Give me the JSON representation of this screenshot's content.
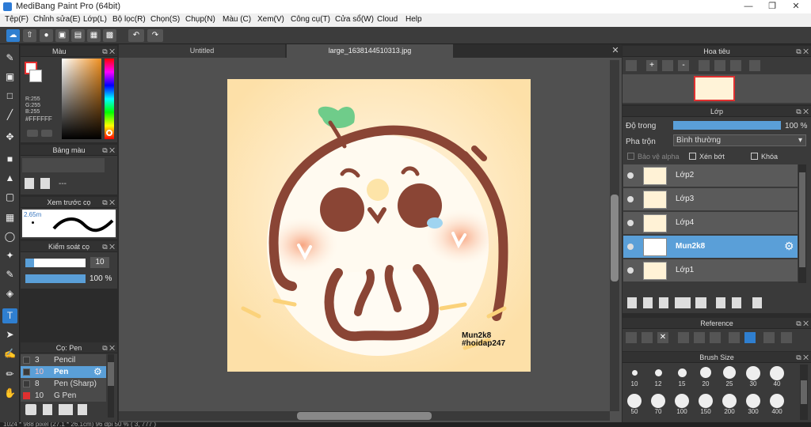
{
  "window": {
    "title": "MediBang Paint Pro (64bit)"
  },
  "menu": [
    "Tệp(F)",
    "Chỉnh sửa(E)",
    "Lớp(L)",
    "Bộ lọc(R)",
    "Chọn(S)",
    "Chụp(N)",
    "Màu (C)",
    "Xem(V)",
    "Công cụ(T)",
    "Cửa sổ(W)",
    "Cloud",
    "Help"
  ],
  "color_panel": {
    "title": "Màu",
    "rgb": [
      "R:255",
      "G:255",
      "B:255"
    ],
    "hex": "#FFFFFF",
    "fg": "#e53030",
    "bg": "#ffffff"
  },
  "palette_panel": {
    "title": "Bảng màu",
    "value": "---"
  },
  "preview_panel": {
    "title": "Xem trước cọ",
    "size": "2.65m"
  },
  "brush_control": {
    "title": "Kiểm soát cọ",
    "size": "10",
    "opacity": "100 %"
  },
  "brush_list": {
    "title": "Cọ: Pen",
    "items": [
      {
        "size": "3",
        "name": "Pencil",
        "color": "#3a3a3a",
        "selected": false
      },
      {
        "size": "10",
        "name": "Pen",
        "color": "#3a3a3a",
        "selected": true
      },
      {
        "size": "8",
        "name": "Pen (Sharp)",
        "color": "#3a3a3a",
        "selected": false
      },
      {
        "size": "10",
        "name": "G Pen",
        "color": "#e03030",
        "selected": false
      }
    ]
  },
  "tabs": [
    "Untitled",
    "large_1638144510313.jpg"
  ],
  "artwork": {
    "signature": "Mun2k8",
    "tag": "#hoidap247"
  },
  "navigator": {
    "title": "Hoa tiêu"
  },
  "layers_panel": {
    "title": "Lớp",
    "opacity_label": "Độ trong",
    "opacity_value": "100 %",
    "blend_label": "Pha trộn",
    "blend_value": "Bình thường",
    "protect_alpha": "Bảo vệ alpha",
    "clipping": "Xén bớt",
    "lock": "Khóa",
    "layers": [
      {
        "name": "Lớp2",
        "selected": false
      },
      {
        "name": "Lớp3",
        "selected": false
      },
      {
        "name": "Lớp4",
        "selected": false
      },
      {
        "name": "Mun2k8",
        "selected": true
      },
      {
        "name": "Lớp1",
        "selected": false
      }
    ]
  },
  "reference_panel": {
    "title": "Reference"
  },
  "brush_size_panel": {
    "title": "Brush Size",
    "sizes": [
      "10",
      "12",
      "15",
      "20",
      "25",
      "30",
      "40",
      "50",
      "70",
      "100",
      "150",
      "200",
      "300",
      "400"
    ]
  },
  "status": "1024 * 988 pixel  (27.1 * 26.1cm)  96 dpi  50 %  ( 3, 777 )"
}
